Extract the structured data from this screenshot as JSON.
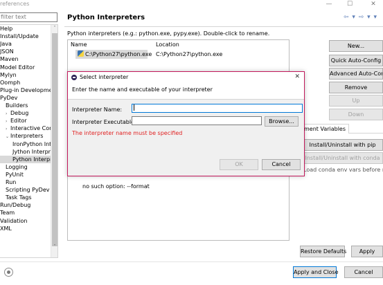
{
  "window": {
    "title": "references",
    "controls": {
      "minimize": "—",
      "maximize": "☐",
      "close": "✕"
    }
  },
  "sidebar": {
    "filter_placeholder": "filter text",
    "items": [
      {
        "label": "Help",
        "arrow": ""
      },
      {
        "label": "Install/Update",
        "arrow": ""
      },
      {
        "label": "Java",
        "arrow": ""
      },
      {
        "label": "JSON",
        "arrow": ""
      },
      {
        "label": "Maven",
        "arrow": ""
      },
      {
        "label": "Model Editor",
        "arrow": ""
      },
      {
        "label": "Mylyn",
        "arrow": ""
      },
      {
        "label": "Oomph",
        "arrow": ""
      },
      {
        "label": "Plug-in Development",
        "arrow": ""
      },
      {
        "label": "PyDev",
        "arrow": ""
      },
      {
        "label": "Builders",
        "arrow": ""
      },
      {
        "label": "Debug",
        "arrow": "›"
      },
      {
        "label": "Editor",
        "arrow": "›"
      },
      {
        "label": "Interactive Console",
        "arrow": "›"
      },
      {
        "label": "Interpreters",
        "arrow": "⌄"
      },
      {
        "label": "IronPython Inte",
        "arrow": ""
      },
      {
        "label": "Jython Interpre",
        "arrow": ""
      },
      {
        "label": "Python Interpre",
        "arrow": ""
      },
      {
        "label": "Logging",
        "arrow": ""
      },
      {
        "label": "PyUnit",
        "arrow": ""
      },
      {
        "label": "Run",
        "arrow": ""
      },
      {
        "label": "Scripting PyDev",
        "arrow": ""
      },
      {
        "label": "Task Tags",
        "arrow": ""
      },
      {
        "label": "Run/Debug",
        "arrow": ""
      },
      {
        "label": "Team",
        "arrow": ""
      },
      {
        "label": "Validation",
        "arrow": ""
      },
      {
        "label": "XML",
        "arrow": ""
      }
    ],
    "scroll_up": "˄",
    "scroll_down": "˅",
    "scroll_right": "›"
  },
  "pane": {
    "title": "Python Interpreters",
    "nav_icons": "⇦ ▾ ⇨ ▾ ▾",
    "description": "Python interpreters (e.g.: python.exe, pypy.exe).   Double-click to rename.",
    "table": {
      "headers": [
        "Name",
        "Location"
      ],
      "rows": [
        {
          "name": "C:\\Python27\\python.exe",
          "location": "C:\\Python27\\python.exe"
        }
      ]
    },
    "side_buttons": {
      "new": "New...",
      "quick_auto": "Quick Auto-Config",
      "advanced_auto": "Advanced Auto-Config",
      "remove": "Remove",
      "up": "Up",
      "down": "Down"
    },
    "tab_env": "ment Variables",
    "pip_button": "Install/Uninstall with pip",
    "conda_button": "Install/Uninstall with conda",
    "conda_label": "Load conda env vars before run?",
    "output_line": "no such option: --format",
    "restore_defaults": "Restore Defaults",
    "apply": "Apply"
  },
  "footer": {
    "apply_close": "Apply and Close",
    "cancel": "Cancel"
  },
  "dialog": {
    "title": "Select interpreter",
    "close": "✕",
    "header": "Enter the name and executable of your interpreter",
    "name_label": "Interpreter Name:",
    "name_value": "",
    "exe_label": "Interpreter Executable:",
    "exe_value": "",
    "browse": "Browse...",
    "error": "The interpreter name must be specified",
    "ok": "OK",
    "cancel": "Cancel"
  },
  "colors": {
    "dialog_border": "#c2185b",
    "error_text": "#e02020",
    "focus_border": "#0078d7",
    "selection": "#d9d9d9"
  }
}
